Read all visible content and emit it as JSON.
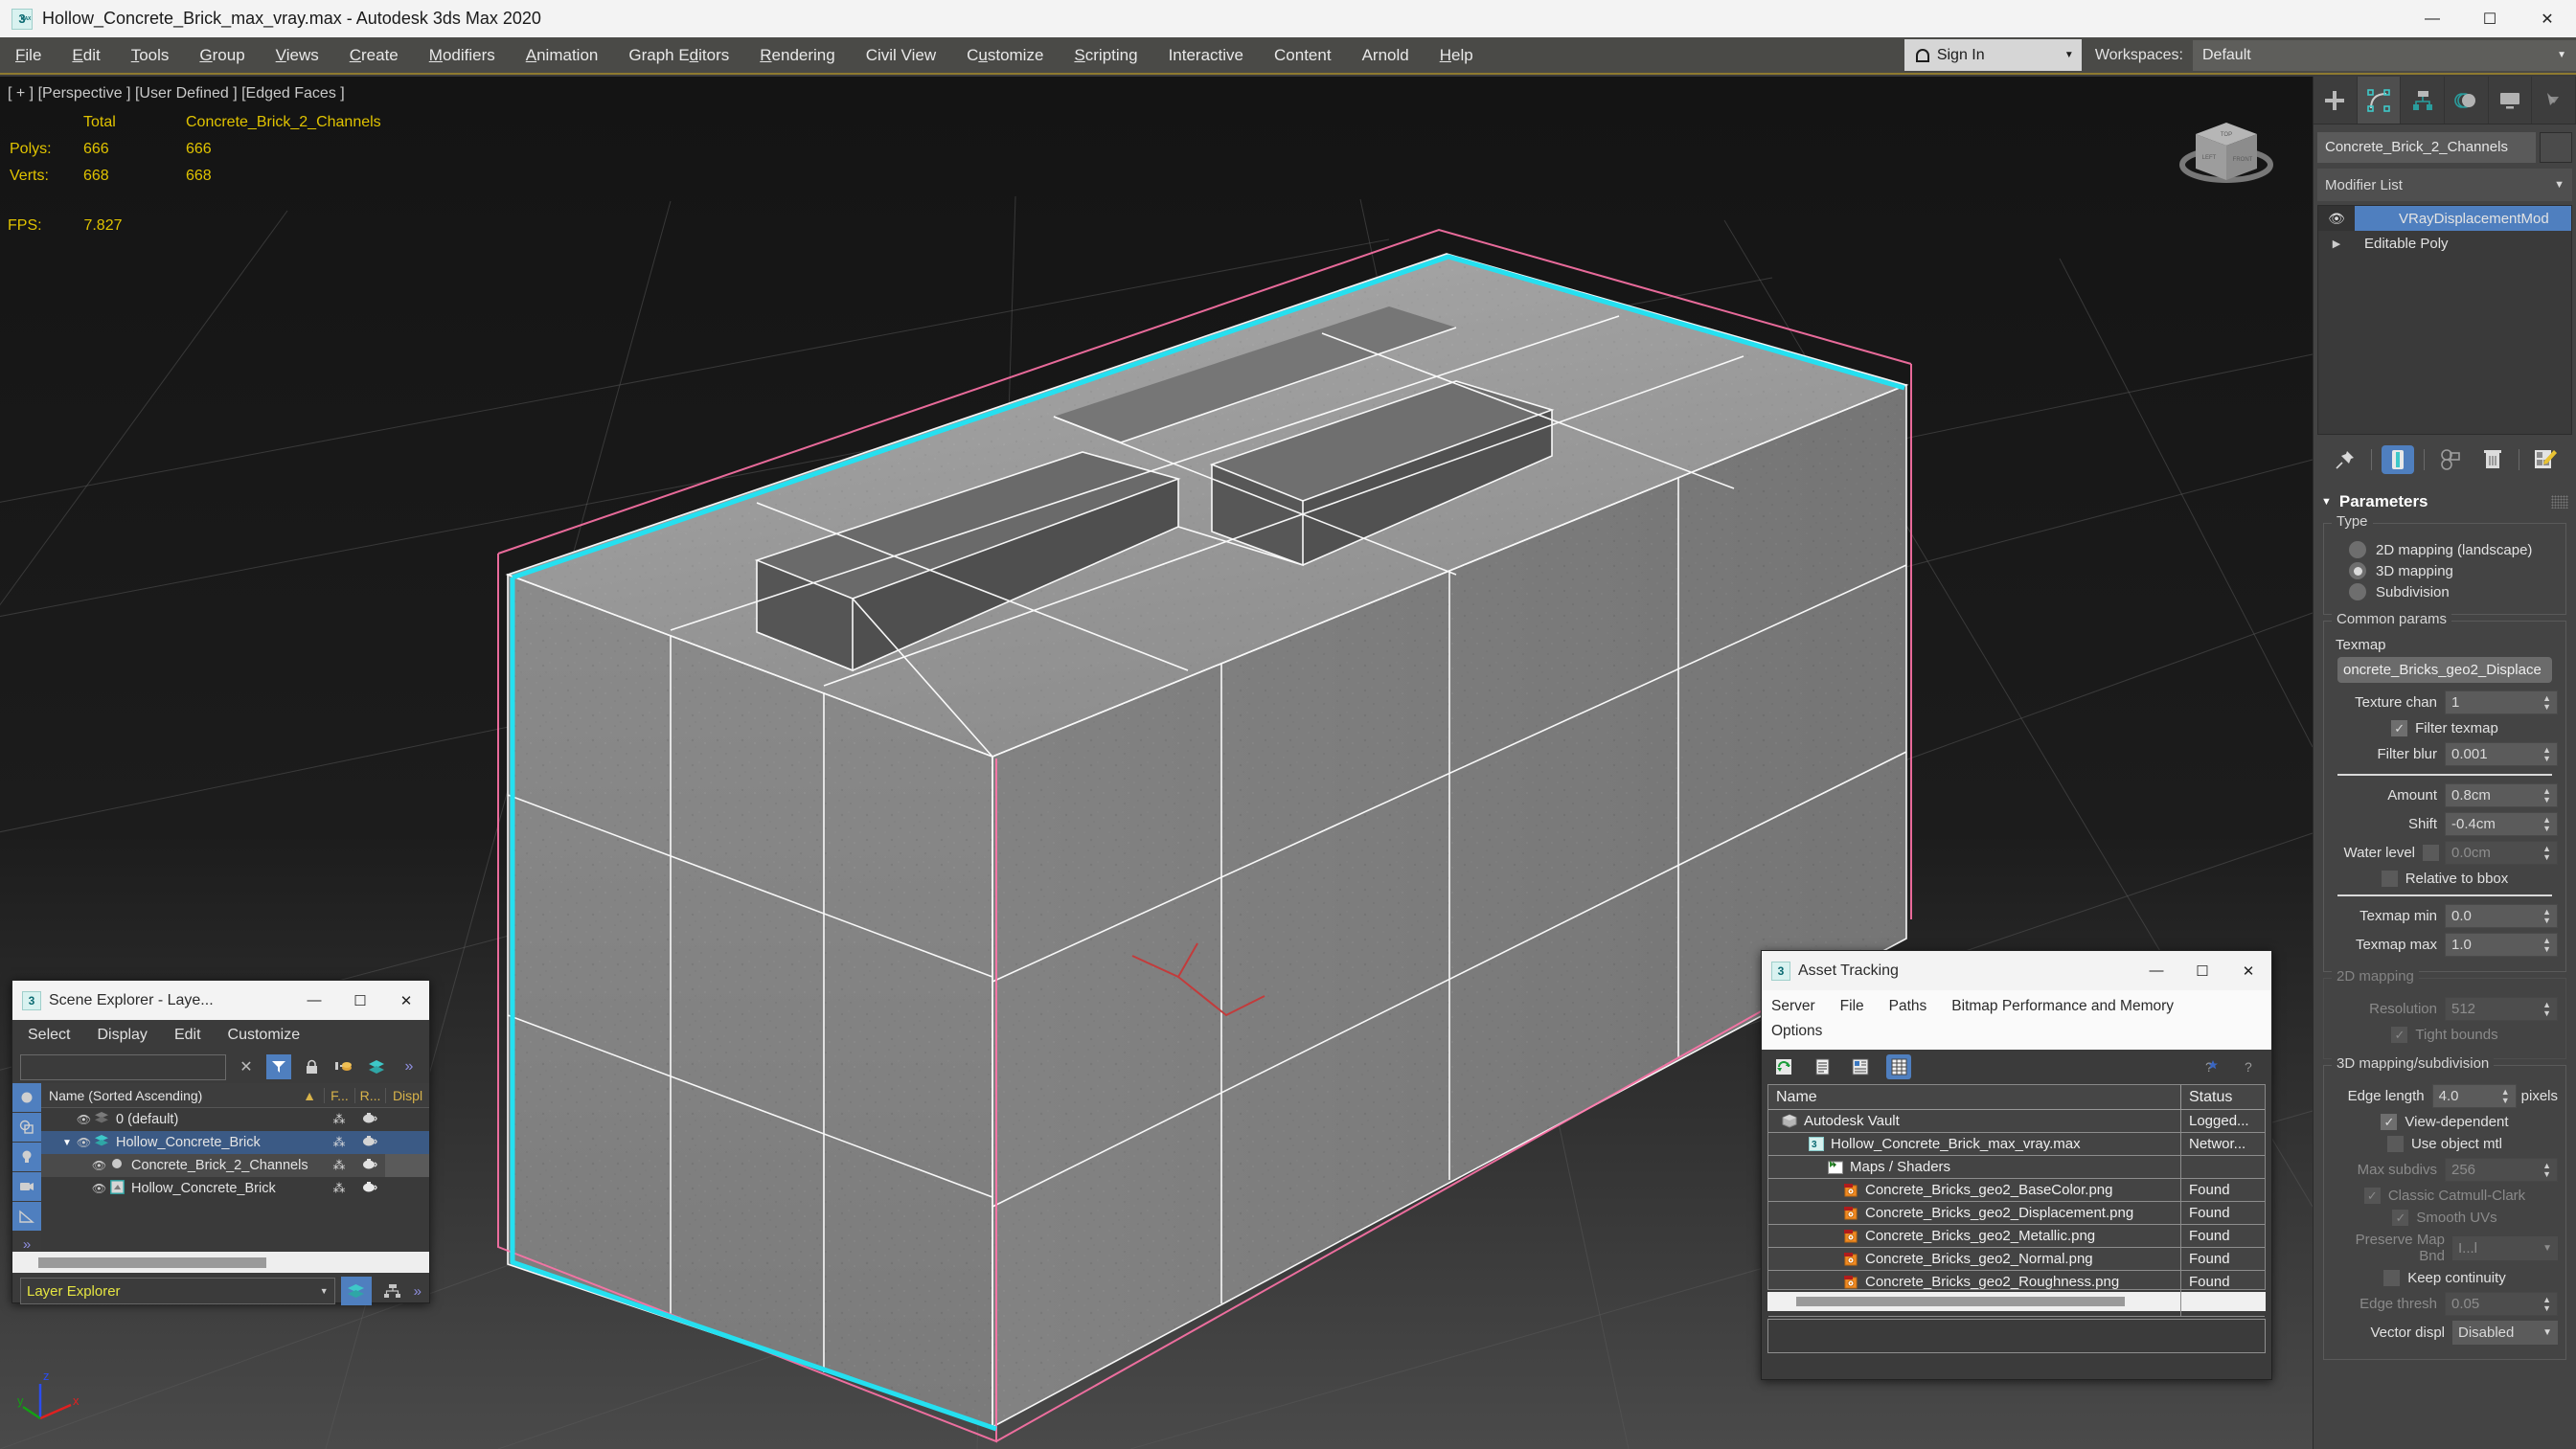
{
  "window": {
    "title": "Hollow_Concrete_Brick_max_vray.max - Autodesk 3ds Max 2020",
    "minimize": "—",
    "maximize": "☐",
    "close": "✕",
    "app_icon_label": "3"
  },
  "menubar": {
    "items": [
      {
        "label": "File",
        "mnemonic": "F"
      },
      {
        "label": "Edit",
        "mnemonic": "E"
      },
      {
        "label": "Tools",
        "mnemonic": "T"
      },
      {
        "label": "Group",
        "mnemonic": "G"
      },
      {
        "label": "Views",
        "mnemonic": "V"
      },
      {
        "label": "Create",
        "mnemonic": "C"
      },
      {
        "label": "Modifiers",
        "mnemonic": "M"
      },
      {
        "label": "Animation",
        "mnemonic": "A"
      },
      {
        "label": "Graph Editors",
        "mnemonic": "d"
      },
      {
        "label": "Rendering",
        "mnemonic": "R"
      },
      {
        "label": "Civil View",
        "mnemonic": ""
      },
      {
        "label": "Customize",
        "mnemonic": "u"
      },
      {
        "label": "Scripting",
        "mnemonic": "S"
      },
      {
        "label": "Interactive",
        "mnemonic": ""
      },
      {
        "label": "Content",
        "mnemonic": ""
      },
      {
        "label": "Arnold",
        "mnemonic": ""
      },
      {
        "label": "Help",
        "mnemonic": "H"
      }
    ],
    "sign_in": "Sign In",
    "workspaces_label": "Workspaces:",
    "workspaces_value": "Default"
  },
  "viewport": {
    "label_line": "[ + ] [Perspective ] [User Defined ] [Edged Faces ]",
    "stats": {
      "col_total": "Total",
      "col_object": "Concrete_Brick_2_Channels",
      "rows": [
        {
          "key": "Polys:",
          "total": "666",
          "object": "666"
        },
        {
          "key": "Verts:",
          "total": "668",
          "object": "668"
        }
      ],
      "fps_key": "FPS:",
      "fps_value": "7.827"
    },
    "axis": {
      "x": "x",
      "y": "y",
      "z": "z"
    },
    "viewcube": {
      "top": "TOP",
      "left": "LEFT",
      "front": "FRONT"
    },
    "selection_color": "#25e0f0",
    "gizmo_color": "#ff73a8"
  },
  "command_panel": {
    "tabs": [
      {
        "name": "create-tab",
        "icon": "plus-icon"
      },
      {
        "name": "modify-tab",
        "icon": "modify-icon"
      },
      {
        "name": "hierarchy-tab",
        "icon": "hierarchy-icon"
      },
      {
        "name": "motion-tab",
        "icon": "motion-icon"
      },
      {
        "name": "display-tab",
        "icon": "display-icon"
      },
      {
        "name": "utilities-tab",
        "icon": "utilities-icon"
      }
    ],
    "active_tab_index": 1,
    "object_name": "Concrete_Brick_2_Channels",
    "modifier_list_label": "Modifier List",
    "stack": [
      {
        "label": "VRayDisplacementMod",
        "selected": true
      },
      {
        "label": "Editable Poly",
        "selected": false
      }
    ],
    "stack_tools": [
      "pin-stack-icon",
      "show-end-result-icon",
      "make-unique-icon",
      "remove-modifier-icon",
      "configure-sets-icon"
    ],
    "rollout": {
      "title": "Parameters",
      "type_group": {
        "title": "Type",
        "options": [
          {
            "label": "2D mapping (landscape)",
            "selected": false
          },
          {
            "label": "3D mapping",
            "selected": true
          },
          {
            "label": "Subdivision",
            "selected": false
          }
        ]
      },
      "common_params": {
        "title": "Common params",
        "texmap_label": "Texmap",
        "texmap_value": "oncrete_Bricks_geo2_Displace",
        "texture_chan_label": "Texture chan",
        "texture_chan_value": "1",
        "filter_texmap_label": "Filter texmap",
        "filter_texmap_checked": true,
        "filter_blur_label": "Filter blur",
        "filter_blur_value": "0.001",
        "amount_label": "Amount",
        "amount_value": "0.8cm",
        "shift_label": "Shift",
        "shift_value": "-0.4cm",
        "water_level_label": "Water level",
        "water_level_checked": false,
        "water_level_value": "0.0cm",
        "relative_bbox_label": "Relative to bbox",
        "relative_bbox_checked": false,
        "texmap_min_label": "Texmap min",
        "texmap_min_value": "0.0",
        "texmap_max_label": "Texmap max",
        "texmap_max_value": "1.0"
      },
      "mapping_2d": {
        "title": "2D mapping",
        "resolution_label": "Resolution",
        "resolution_value": "512",
        "tight_bounds_label": "Tight bounds",
        "tight_bounds_checked": true
      },
      "mapping_3d": {
        "title": "3D mapping/subdivision",
        "edge_length_label": "Edge length",
        "edge_length_value": "4.0",
        "edge_length_units": "pixels",
        "view_dependent_label": "View-dependent",
        "view_dependent_checked": true,
        "use_object_mtl_label": "Use object mtl",
        "use_object_mtl_checked": false,
        "max_subdivs_label": "Max subdivs",
        "max_subdivs_value": "256",
        "classic_cc_label": "Classic Catmull-Clark",
        "classic_cc_checked": false,
        "smooth_uvs_label": "Smooth UVs",
        "smooth_uvs_checked": true,
        "preserve_map_label": "Preserve Map Bnd",
        "preserve_map_value": "I...l",
        "keep_continuity_label": "Keep continuity",
        "keep_continuity_checked": false,
        "edge_thresh_label": "Edge thresh",
        "edge_thresh_value": "0.05",
        "vector_displ_label": "Vector displ",
        "vector_displ_value": "Disabled"
      }
    }
  },
  "scene_explorer": {
    "title": "Scene Explorer - Laye...",
    "minimize": "—",
    "maximize": "☐",
    "close": "✕",
    "menu": [
      "Select",
      "Display",
      "Edit",
      "Customize"
    ],
    "search_value": "",
    "toolbar": [
      "clear-search-icon",
      "filter-icon",
      "lock-icon",
      "add-layer-icon",
      "select-layer-icon",
      "more-icon"
    ],
    "columns": {
      "name": "Name (Sorted Ascending)",
      "sort": "▲",
      "freeze": "F...",
      "render": "R...",
      "display": "Displ"
    },
    "rows": [
      {
        "label": "0 (default)",
        "indent": 1,
        "icon": "layer-icon",
        "selected": false,
        "freeze": "⁂",
        "render": "teapot-icon"
      },
      {
        "label": "Hollow_Concrete_Brick",
        "indent": 1,
        "icon": "layer-icon-active",
        "selected": true,
        "expanded": true,
        "freeze": "⁂",
        "render": "teapot-icon"
      },
      {
        "label": "Concrete_Brick_2_Channels",
        "indent": 2,
        "icon": "object-icon",
        "selected": false,
        "highlight": true,
        "freeze": "⁂",
        "render": "teapot-icon"
      },
      {
        "label": "Hollow_Concrete_Brick",
        "indent": 2,
        "icon": "xref-icon",
        "selected": false,
        "freeze": "⁂",
        "render": "teapot-icon"
      }
    ],
    "footer_mode": "Layer Explorer",
    "footer_buttons": [
      "layer-view-icon",
      "hierarchy-view-icon",
      "more-icon"
    ]
  },
  "asset_tracking": {
    "title": "Asset Tracking",
    "minimize": "—",
    "maximize": "☐",
    "close": "✕",
    "menu_row1": [
      "Server",
      "File",
      "Paths",
      "Bitmap Performance and Memory"
    ],
    "menu_row2": [
      "Options"
    ],
    "toolbar": [
      "refresh-icon",
      "list-view-icon",
      "detail-view-icon",
      "grid-view-icon"
    ],
    "toolbar_right": [
      "help-new-icon",
      "help-icon"
    ],
    "columns": {
      "name": "Name",
      "status": "Status"
    },
    "rows": [
      {
        "name": "Autodesk Vault",
        "status": "Logged...",
        "indent": 0,
        "icon": "vault-icon"
      },
      {
        "name": "Hollow_Concrete_Brick_max_vray.max",
        "status": "Networ...",
        "indent": 1,
        "icon": "max-file-icon"
      },
      {
        "name": "Maps / Shaders",
        "status": "",
        "indent": 2,
        "icon": "maps-icon"
      },
      {
        "name": "Concrete_Bricks_geo2_BaseColor.png",
        "status": "Found",
        "indent": 3,
        "icon": "png-icon"
      },
      {
        "name": "Concrete_Bricks_geo2_Displacement.png",
        "status": "Found",
        "indent": 3,
        "icon": "png-icon"
      },
      {
        "name": "Concrete_Bricks_geo2_Metallic.png",
        "status": "Found",
        "indent": 3,
        "icon": "png-icon"
      },
      {
        "name": "Concrete_Bricks_geo2_Normal.png",
        "status": "Found",
        "indent": 3,
        "icon": "png-icon"
      },
      {
        "name": "Concrete_Bricks_geo2_Roughness.png",
        "status": "Found",
        "indent": 3,
        "icon": "png-icon"
      }
    ]
  }
}
